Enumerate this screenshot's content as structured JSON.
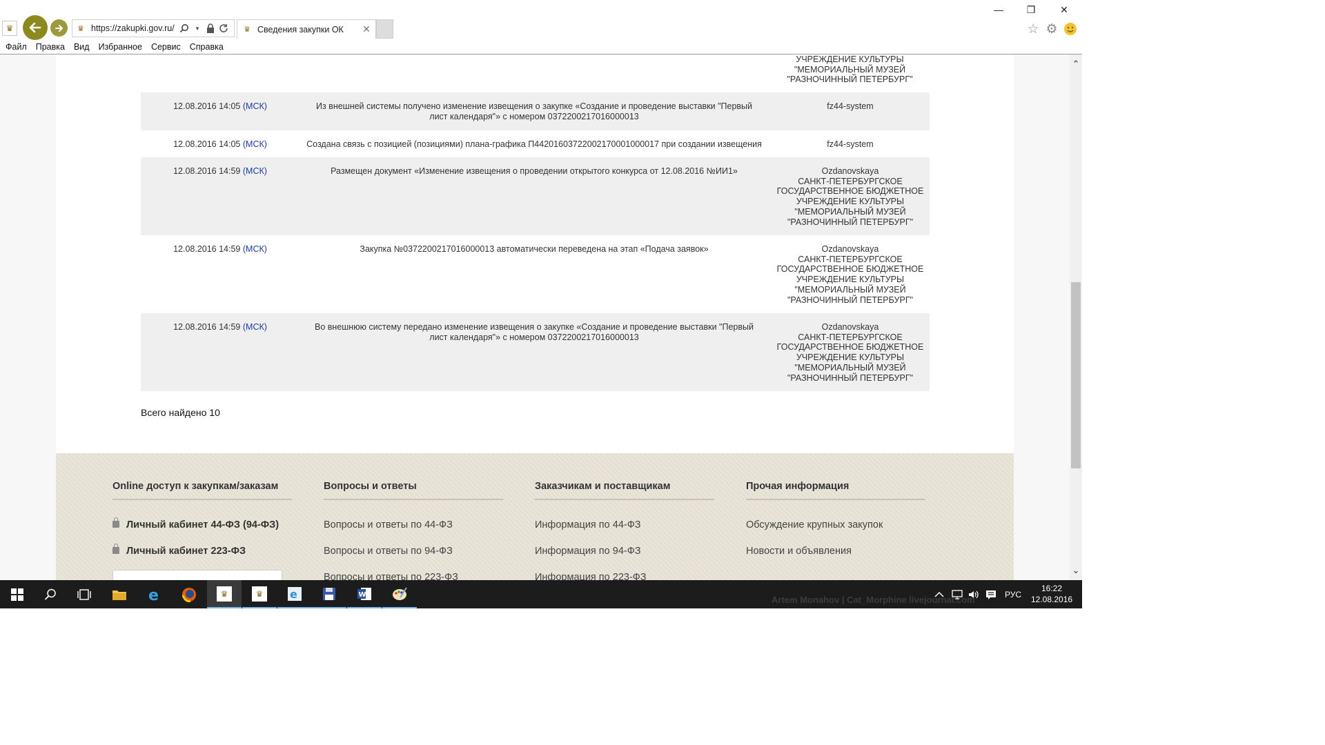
{
  "browser": {
    "url": "https://zakupki.gov.ru/",
    "tab_title": "Сведения закупки ОК",
    "menu": [
      "Файл",
      "Правка",
      "Вид",
      "Избранное",
      "Сервис",
      "Справка"
    ]
  },
  "log": {
    "top_partial_user": "УЧРЕЖДЕНИЕ КУЛЬТУРЫ\n\"МЕМОРИАЛЬНЫЙ МУЗЕЙ\n\"РАЗНОЧИННЫЙ ПЕТЕРБУРГ\"",
    "rows": [
      {
        "date": "12.08.2016 14:05",
        "tz": "(МСК)",
        "event": "Из внешней системы получено изменение извещения о закупке «Создание и проведение выставки \"Первый лист календаря\"» с номером 0372200217016000013",
        "user": "fz44-system"
      },
      {
        "date": "12.08.2016 14:05",
        "tz": "(МСК)",
        "event": "Создана связь с позицией (позициями) плана-графика П44201603722002170001000017 при создании извещения",
        "user": "fz44-system"
      },
      {
        "date": "12.08.2016 14:59",
        "tz": "(МСК)",
        "event": "Размещен документ «Изменение извещения о проведении открытого конкурса от 12.08.2016 №ИИ1»",
        "user": "Ozdanovskaya\nСАНКТ-ПЕТЕРБУРГСКОЕ\nГОСУДАРСТВЕННОЕ БЮДЖЕТНОЕ\nУЧРЕЖДЕНИЕ КУЛЬТУРЫ\n\"МЕМОРИАЛЬНЫЙ МУЗЕЙ\n\"РАЗНОЧИННЫЙ ПЕТЕРБУРГ\""
      },
      {
        "date": "12.08.2016 14:59",
        "tz": "(МСК)",
        "event": "Закупка №0372200217016000013 автоматически переведена на этап «Подача заявок»",
        "user": "Ozdanovskaya\nСАНКТ-ПЕТЕРБУРГСКОЕ\nГОСУДАРСТВЕННОЕ БЮДЖЕТНОЕ\nУЧРЕЖДЕНИЕ КУЛЬТУРЫ\n\"МЕМОРИАЛЬНЫЙ МУЗЕЙ\n\"РАЗНОЧИННЫЙ ПЕТЕРБУРГ\""
      },
      {
        "date": "12.08.2016 14:59",
        "tz": "(МСК)",
        "event": "Во внешнюю систему передано изменение извещения о закупке «Создание и проведение выставки \"Первый лист календаря\"» с номером 0372200217016000013",
        "user": "Ozdanovskaya\nСАНКТ-ПЕТЕРБУРГСКОЕ\nГОСУДАРСТВЕННОЕ БЮДЖЕТНОЕ\nУЧРЕЖДЕНИЕ КУЛЬТУРЫ\n\"МЕМОРИАЛЬНЫЙ МУЗЕЙ\n\"РАЗНОЧИННЫЙ ПЕТЕРБУРГ\""
      }
    ],
    "total_label": "Всего найдено 10"
  },
  "footer": {
    "columns": [
      {
        "heading": "Online доступ к закупкам/заказам",
        "links": [
          "Личный кабинет 44-ФЗ (94-ФЗ)",
          "Личный кабинет 223-ФЗ"
        ]
      },
      {
        "heading": "Вопросы и ответы",
        "links": [
          "Вопросы и ответы по 44-ФЗ",
          "Вопросы и ответы по 94-ФЗ",
          "Вопросы и ответы по 223-ФЗ"
        ]
      },
      {
        "heading": "Заказчикам и поставщикам",
        "links": [
          "Информация по 44-ФЗ",
          "Информация по 94-ФЗ",
          "Информация по 223-ФЗ"
        ]
      },
      {
        "heading": "Прочая информация",
        "links": [
          "Обсуждение крупных закупок",
          "Новости и объявления"
        ]
      }
    ]
  },
  "taskbar": {
    "language": "РУС",
    "time": "16:22",
    "date": "12.08.2016",
    "watermark": "Artem Monahov | Cat_Morphine livejournal.com"
  }
}
